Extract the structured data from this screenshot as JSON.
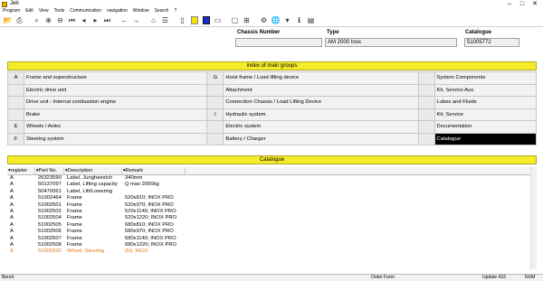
{
  "window": {
    "title": "Jeb"
  },
  "menu": [
    "Program",
    "Edit",
    "View",
    "Tools",
    "Communication",
    "navigation",
    "Window",
    "Search",
    "?"
  ],
  "chassis": {
    "chassis_number_label": "Chassis Number",
    "chassis_number_value": "",
    "type_label": "Type",
    "type_value": "AM 2000 Inox",
    "catalogue_label": "Catalogue",
    "catalogue_value": "51005772"
  },
  "index": {
    "title": "index of main groups",
    "rows": [
      [
        {
          "letter": "A",
          "label": "Frame and superstructure"
        },
        {
          "letter": "G",
          "label": "Hoist frame / Load lifting device"
        },
        {
          "letter": "",
          "label": "System Components"
        }
      ],
      [
        {
          "letter": "",
          "label": "Electric drive unit"
        },
        {
          "letter": "",
          "label": "Attachment"
        },
        {
          "letter": "",
          "label": "Kit, Service Aux."
        }
      ],
      [
        {
          "letter": "",
          "label": "Drive unit - Internal combustion engine"
        },
        {
          "letter": "",
          "label": "Connection Chassis / Load Lifting Device"
        },
        {
          "letter": "",
          "label": "Lubes and Fluids"
        }
      ],
      [
        {
          "letter": "",
          "label": "Brake"
        },
        {
          "letter": "I",
          "label": "Hydraulic system"
        },
        {
          "letter": "",
          "label": "Kit, Service"
        }
      ],
      [
        {
          "letter": "E",
          "label": "Wheels / Axles"
        },
        {
          "letter": "",
          "label": "Electric system"
        },
        {
          "letter": "",
          "label": "Documentation"
        }
      ],
      [
        {
          "letter": "F",
          "label": "Steering system"
        },
        {
          "letter": "",
          "label": "Battery / Charger"
        },
        {
          "letter": "",
          "label": "Catalogue"
        }
      ]
    ]
  },
  "catalogue": {
    "title": "Catalogue",
    "columns": [
      "register",
      "Part No.",
      "Description",
      "Remark"
    ],
    "rows": [
      [
        "A",
        "26323590",
        "Label, Jungheinrich",
        "340mm"
      ],
      [
        "A",
        "50137097",
        "Label, Lifting capacity",
        "Q max 2000kg"
      ],
      [
        "A",
        "50470061",
        "Label, Lift/Lowering",
        ""
      ],
      [
        "A",
        "51002464",
        "Frame",
        "520x810; INOX PRO"
      ],
      [
        "A",
        "51002501",
        "Frame",
        "520x970; INOX PRO"
      ],
      [
        "A",
        "51002502",
        "Frame",
        "520x1140; INOX PRO"
      ],
      [
        "A",
        "51002504",
        "Frame",
        "520x1220; INOX PRO"
      ],
      [
        "A",
        "51002505",
        "Frame",
        "680x810; INOX PRO"
      ],
      [
        "A",
        "51002506",
        "Frame",
        "680x970; INOX PRO"
      ],
      [
        "A",
        "51002507",
        "Frame",
        "680x1140; INOX PRO"
      ],
      [
        "A",
        "51002508",
        "Frame",
        "680x1220; INOX PRO"
      ],
      [
        "A",
        "51005932",
        "Wheel, Steering",
        "(N); INOX"
      ]
    ]
  },
  "status": {
    "left": "Bereit",
    "middle": "Order Form",
    "update": "Update 433",
    "right": "NUM"
  },
  "colors": {
    "header_yellow": "#f5eb2a",
    "highlight_orange": "#e07a1a",
    "selected_bg": "#000000"
  }
}
